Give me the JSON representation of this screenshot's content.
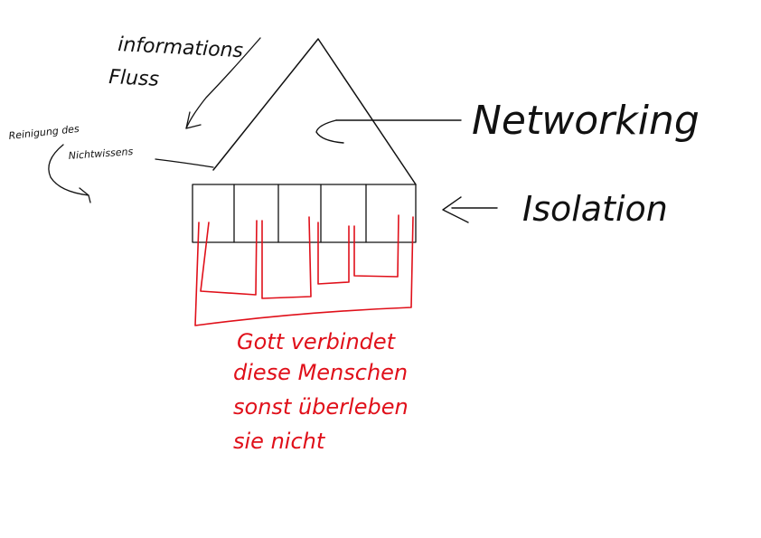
{
  "labels": {
    "informationsfluss_line1": "informations",
    "informationsfluss_line2": "Fluss",
    "reinigung_line1": "Reinigung des",
    "reinigung_line2": "Nichtwissens",
    "networking": "Networking",
    "isolation": "Isolation"
  },
  "red_note": {
    "line1": "Gott verbindet",
    "line2": "diese Menschen",
    "line3": "sonst überleben",
    "line4": "sie nicht"
  },
  "colors": {
    "ink": "#111111",
    "red_ink": "#e0101a",
    "background": "#ffffff"
  }
}
